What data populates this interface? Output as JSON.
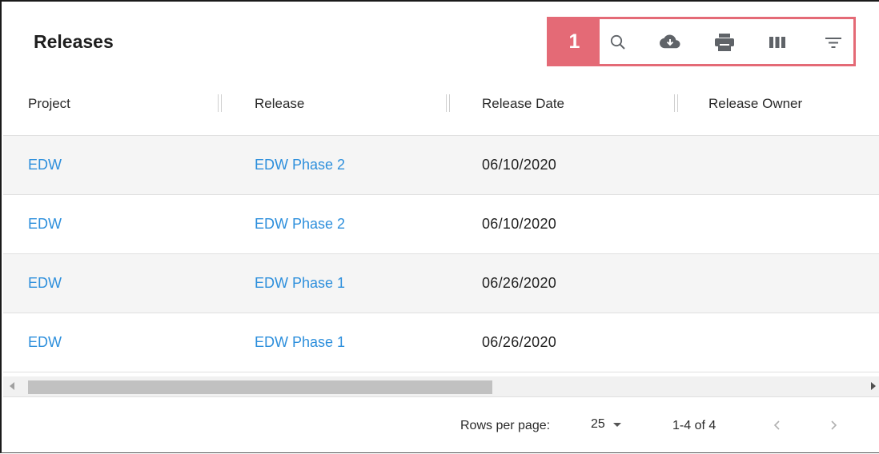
{
  "title": "Releases",
  "callout_number": "1",
  "toolbar_icons": [
    "search-icon",
    "cloud-download-icon",
    "print-icon",
    "view-column-icon",
    "filter-list-icon"
  ],
  "colors": {
    "accent_callout": "#e46a76",
    "link": "#2d8fdc"
  },
  "columns": [
    "Project",
    "Release",
    "Release Date",
    "Release Owner"
  ],
  "rows": [
    {
      "project": "EDW",
      "release": "EDW Phase 2",
      "release_date": "06/10/2020",
      "release_owner": ""
    },
    {
      "project": "EDW",
      "release": "EDW Phase 2",
      "release_date": "06/10/2020",
      "release_owner": ""
    },
    {
      "project": "EDW",
      "release": "EDW Phase 1",
      "release_date": "06/26/2020",
      "release_owner": ""
    },
    {
      "project": "EDW",
      "release": "EDW Phase 1",
      "release_date": "06/26/2020",
      "release_owner": ""
    }
  ],
  "pagination": {
    "rows_per_page_label": "Rows per page:",
    "rows_per_page_value": "25",
    "range": "1-4 of 4"
  }
}
